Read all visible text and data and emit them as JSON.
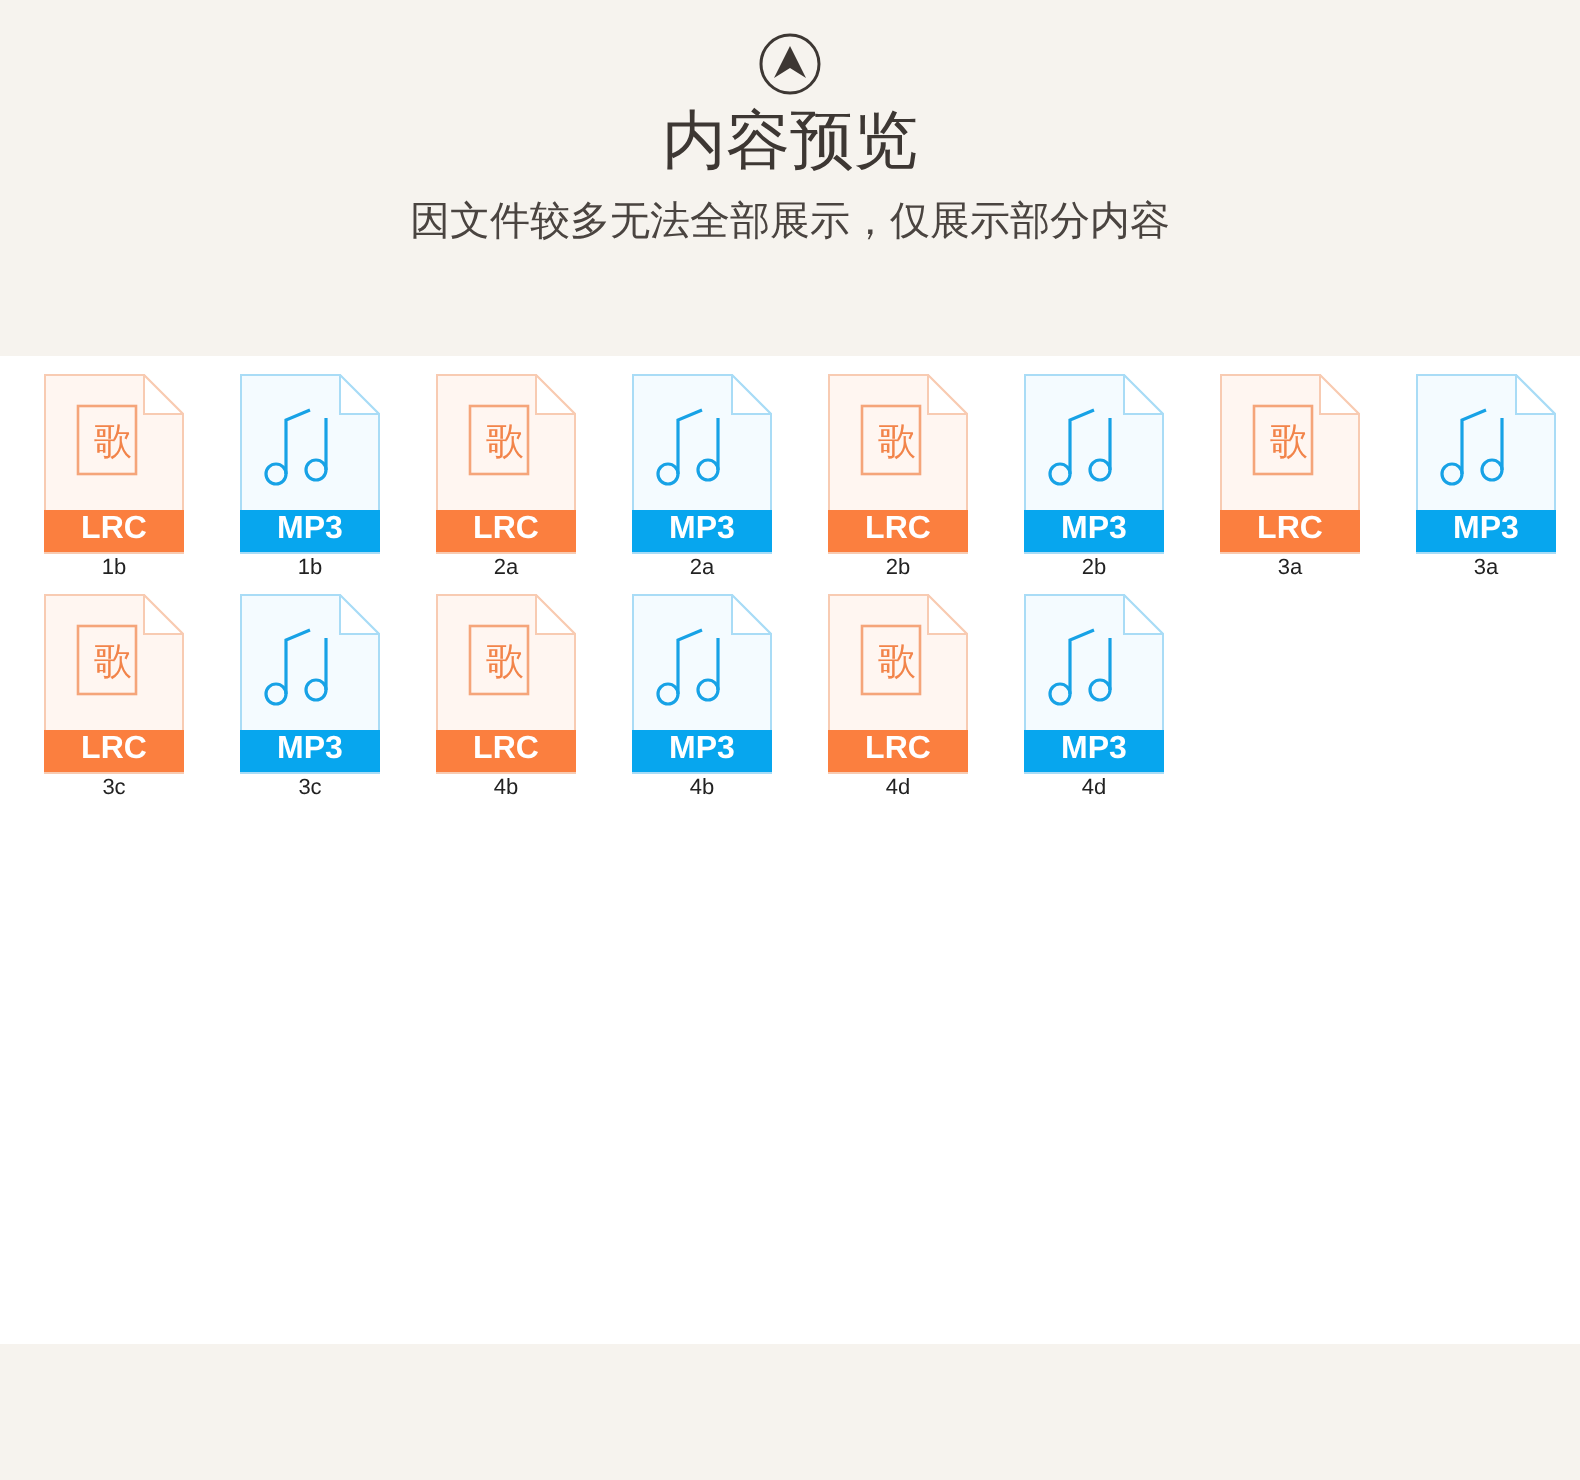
{
  "header": {
    "title": "内容预览",
    "subtitle": "因文件较多无法全部展示，仅展示部分内容"
  },
  "files": [
    {
      "kind": "lrc",
      "type": "LRC",
      "glyph": "歌",
      "name": "1b"
    },
    {
      "kind": "mp3",
      "type": "MP3",
      "name": "1b"
    },
    {
      "kind": "lrc",
      "type": "LRC",
      "glyph": "歌",
      "name": "2a"
    },
    {
      "kind": "mp3",
      "type": "MP3",
      "name": "2a"
    },
    {
      "kind": "lrc",
      "type": "LRC",
      "glyph": "歌",
      "name": "2b"
    },
    {
      "kind": "mp3",
      "type": "MP3",
      "name": "2b"
    },
    {
      "kind": "lrc",
      "type": "LRC",
      "glyph": "歌",
      "name": "3a"
    },
    {
      "kind": "mp3",
      "type": "MP3",
      "name": "3a"
    },
    {
      "kind": "lrc",
      "type": "LRC",
      "glyph": "歌",
      "name": "3c"
    },
    {
      "kind": "mp3",
      "type": "MP3",
      "name": "3c"
    },
    {
      "kind": "lrc",
      "type": "LRC",
      "glyph": "歌",
      "name": "4b"
    },
    {
      "kind": "mp3",
      "type": "MP3",
      "name": "4b"
    },
    {
      "kind": "lrc",
      "type": "LRC",
      "glyph": "歌",
      "name": "4d"
    },
    {
      "kind": "mp3",
      "type": "MP3",
      "name": "4d"
    }
  ]
}
